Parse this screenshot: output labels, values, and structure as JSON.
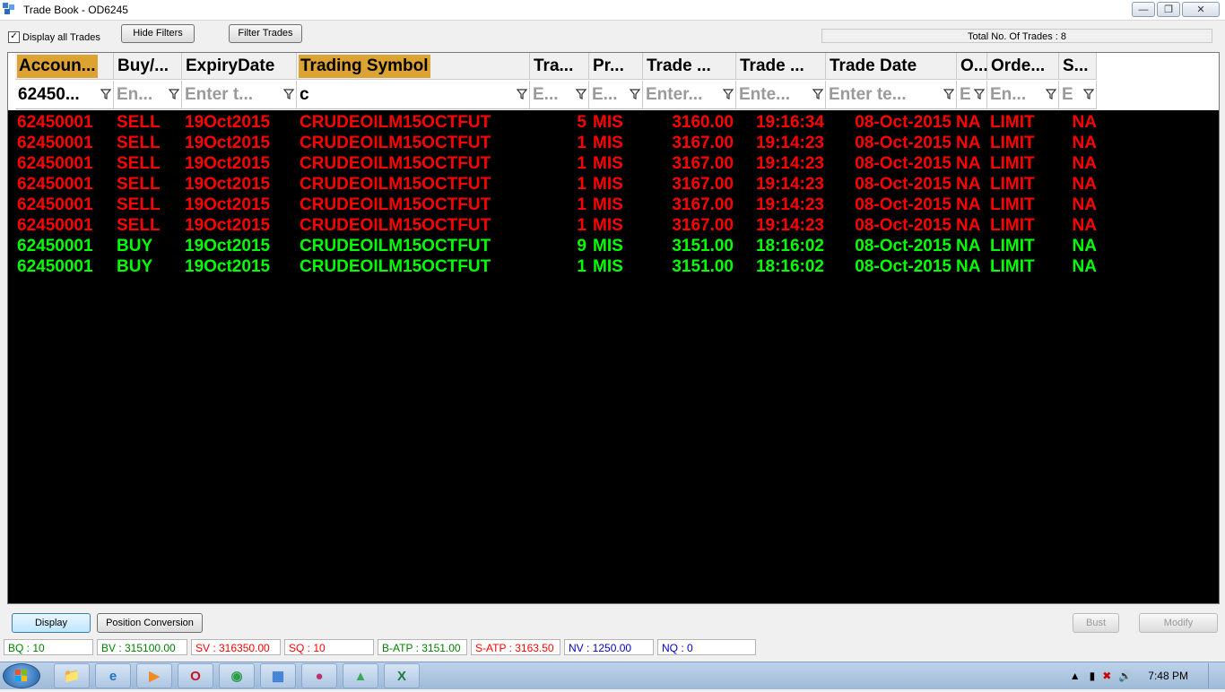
{
  "window": {
    "title": "Trade Book - OD6245"
  },
  "toolbar": {
    "display_all_label": "Display all Trades",
    "display_all_checked": true,
    "hide_filters_label": "Hide Filters",
    "filter_trades_label": "Filter Trades",
    "total_trades_text": "Total No. Of Trades : 8"
  },
  "columns": [
    {
      "header": "Accoun...",
      "filter": "62450...",
      "highlighted": true
    },
    {
      "header": "Buy/...",
      "filter": "En...",
      "highlighted": false
    },
    {
      "header": "ExpiryDate",
      "filter": "Enter t...",
      "highlighted": false
    },
    {
      "header": "Trading Symbol",
      "filter": "c",
      "highlighted": true
    },
    {
      "header": "Tra...",
      "filter": "E...",
      "highlighted": false
    },
    {
      "header": "Pr...",
      "filter": "E...",
      "highlighted": false
    },
    {
      "header": "Trade ...",
      "filter": "Enter...",
      "highlighted": false
    },
    {
      "header": "Trade ...",
      "filter": "Ente...",
      "highlighted": false
    },
    {
      "header": "Trade Date",
      "filter": "Enter te...",
      "highlighted": false
    },
    {
      "header": "O...",
      "filter": "E",
      "highlighted": false
    },
    {
      "header": "Orde...",
      "filter": "En...",
      "highlighted": false
    },
    {
      "header": "S...",
      "filter": "E",
      "highlighted": false
    }
  ],
  "trades": [
    {
      "account": "62450001",
      "side": "SELL",
      "expiry": "19Oct2015",
      "symbol": "CRUDEOILM15OCTFUT",
      "qty": "5",
      "product": "MIS",
      "price": "3160.00",
      "time": "19:16:34",
      "date": "08-Oct-2015",
      "o": "NA",
      "order": "LIMIT",
      "s": "NA"
    },
    {
      "account": "62450001",
      "side": "SELL",
      "expiry": "19Oct2015",
      "symbol": "CRUDEOILM15OCTFUT",
      "qty": "1",
      "product": "MIS",
      "price": "3167.00",
      "time": "19:14:23",
      "date": "08-Oct-2015",
      "o": "NA",
      "order": "LIMIT",
      "s": "NA"
    },
    {
      "account": "62450001",
      "side": "SELL",
      "expiry": "19Oct2015",
      "symbol": "CRUDEOILM15OCTFUT",
      "qty": "1",
      "product": "MIS",
      "price": "3167.00",
      "time": "19:14:23",
      "date": "08-Oct-2015",
      "o": "NA",
      "order": "LIMIT",
      "s": "NA"
    },
    {
      "account": "62450001",
      "side": "SELL",
      "expiry": "19Oct2015",
      "symbol": "CRUDEOILM15OCTFUT",
      "qty": "1",
      "product": "MIS",
      "price": "3167.00",
      "time": "19:14:23",
      "date": "08-Oct-2015",
      "o": "NA",
      "order": "LIMIT",
      "s": "NA"
    },
    {
      "account": "62450001",
      "side": "SELL",
      "expiry": "19Oct2015",
      "symbol": "CRUDEOILM15OCTFUT",
      "qty": "1",
      "product": "MIS",
      "price": "3167.00",
      "time": "19:14:23",
      "date": "08-Oct-2015",
      "o": "NA",
      "order": "LIMIT",
      "s": "NA"
    },
    {
      "account": "62450001",
      "side": "SELL",
      "expiry": "19Oct2015",
      "symbol": "CRUDEOILM15OCTFUT",
      "qty": "1",
      "product": "MIS",
      "price": "3167.00",
      "time": "19:14:23",
      "date": "08-Oct-2015",
      "o": "NA",
      "order": "LIMIT",
      "s": "NA"
    },
    {
      "account": "62450001",
      "side": "BUY",
      "expiry": "19Oct2015",
      "symbol": "CRUDEOILM15OCTFUT",
      "qty": "9",
      "product": "MIS",
      "price": "3151.00",
      "time": "18:16:02",
      "date": "08-Oct-2015",
      "o": "NA",
      "order": "LIMIT",
      "s": "NA"
    },
    {
      "account": "62450001",
      "side": "BUY",
      "expiry": "19Oct2015",
      "symbol": "CRUDEOILM15OCTFUT",
      "qty": "1",
      "product": "MIS",
      "price": "3151.00",
      "time": "18:16:02",
      "date": "08-Oct-2015",
      "o": "NA",
      "order": "LIMIT",
      "s": "NA"
    }
  ],
  "colors": {
    "sell": "#ff0000",
    "buy": "#00ff00",
    "grid_bg": "#000000",
    "header_highlight": "#dca332"
  },
  "actions": {
    "display_label": "Display",
    "position_conversion_label": "Position Conversion",
    "bust_label": "Bust",
    "modify_label": "Modify"
  },
  "status_bar": [
    {
      "text": "BQ : 10",
      "color": "#008000"
    },
    {
      "text": "BV : 315100.00",
      "color": "#008000"
    },
    {
      "text": "SV : 316350.00",
      "color": "#ff0000"
    },
    {
      "text": "SQ : 10",
      "color": "#ff0000"
    },
    {
      "text": "B-ATP : 3151.00",
      "color": "#008000"
    },
    {
      "text": "S-ATP : 3163.50",
      "color": "#ff0000"
    },
    {
      "text": "NV : 1250.00",
      "color": "#0000cc"
    },
    {
      "text": "NQ : 0",
      "color": "#0000cc"
    }
  ],
  "taskbar": {
    "clock": "7:48 PM",
    "apps": [
      "explorer-icon",
      "ie-icon",
      "media-player-icon",
      "opera-icon",
      "chrome-icon",
      "tradebook-app-icon",
      "app-icon",
      "drive-icon",
      "excel-icon"
    ]
  }
}
